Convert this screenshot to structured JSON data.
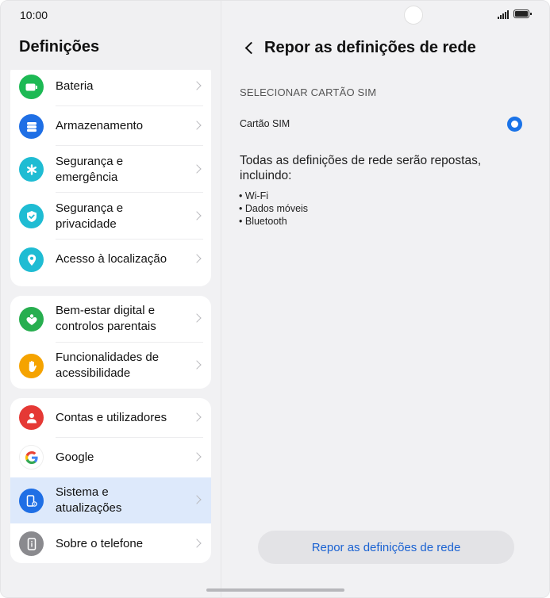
{
  "status": {
    "time": "10:00"
  },
  "left": {
    "title": "Definições",
    "groups": [
      {
        "items": [
          {
            "label": "Bateria",
            "icon": "battery-icon",
            "color": "#1db954"
          },
          {
            "label": "Armazenamento",
            "icon": "storage-icon",
            "color": "#1f6fe5"
          },
          {
            "label": "Segurança e\nemergência",
            "icon": "asterisk-icon",
            "color": "#1fbcd3"
          },
          {
            "label": "Segurança e\nprivacidade",
            "icon": "shield-check-icon",
            "color": "#1fbcd3"
          },
          {
            "label": "Acesso à localização",
            "icon": "location-pin-icon",
            "color": "#1fbcd3"
          }
        ]
      },
      {
        "items": [
          {
            "label": "Bem-estar digital e\ncontrolos parentais",
            "icon": "wellbeing-heart-icon",
            "color": "#27ae4f"
          },
          {
            "label": "Funcionalidades de\nacessibilidade",
            "icon": "hand-icon",
            "color": "#f5a300"
          }
        ]
      },
      {
        "items": [
          {
            "label": "Contas e utilizadores",
            "icon": "user-icon",
            "color": "#e53935"
          },
          {
            "label": "Google",
            "icon": "google-logo-icon",
            "color": "#4285f4"
          },
          {
            "label": "Sistema e\natualizações",
            "icon": "system-phone-icon",
            "color": "#1f6fe5",
            "selected": true
          },
          {
            "label": "Sobre o telefone",
            "icon": "phone-info-icon",
            "color": "#8a8a8e"
          }
        ]
      }
    ]
  },
  "right": {
    "title": "Repor as definições de rede",
    "section_label": "SELECIONAR CARTÃO SIM",
    "sim_label": "Cartão SIM",
    "description": "Todas as definições de rede serão repostas, incluindo:",
    "bullets": [
      "Wi-Fi",
      "Dados móveis",
      "Bluetooth"
    ],
    "button_label": "Repor as definições de rede"
  },
  "colors": {
    "accent": "#1a73e8",
    "selected_bg": "#dde9fb",
    "button_text": "#1a62d2"
  }
}
